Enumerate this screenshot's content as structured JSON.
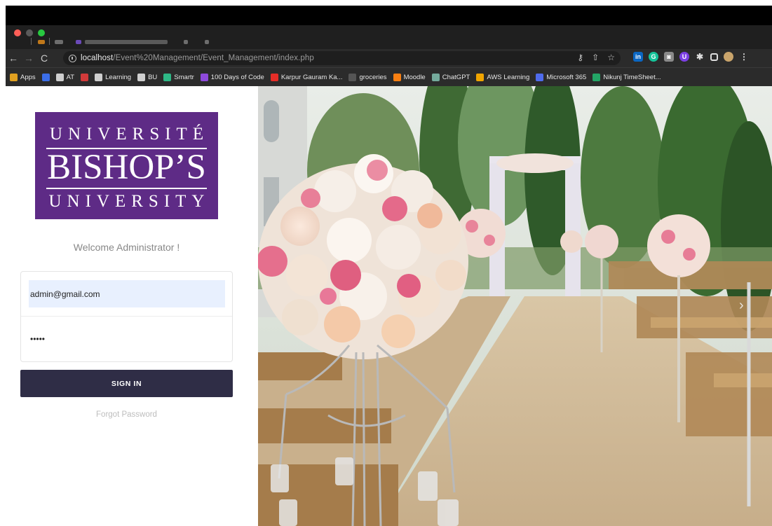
{
  "browser": {
    "url_host": "localhost",
    "url_path": "/Event%20Management/Event_Management/index.php",
    "omnibox_icons": [
      "key-icon",
      "share-icon",
      "star-icon"
    ],
    "extension_icons": [
      "linkedin-icon",
      "grammarly-icon",
      "camera-icon",
      "extension-u-icon",
      "puzzle-icon",
      "sidepanel-icon",
      "profile-icon",
      "menu-icon"
    ],
    "bookmarks": [
      {
        "label": "Apps",
        "icon": "apps-grid-icon",
        "color": "#e0a020"
      },
      {
        "label": "",
        "icon": "bookmark-blue-icon",
        "color": "#3b6ee8"
      },
      {
        "label": "AT",
        "icon": "globe-icon",
        "color": "#cfcfcf"
      },
      {
        "label": "",
        "icon": "bookmark-red-icon",
        "color": "#d23a3a"
      },
      {
        "label": "Learning",
        "icon": "folder-icon",
        "color": "#cfcfcf"
      },
      {
        "label": "BU",
        "icon": "folder-icon",
        "color": "#cfcfcf"
      },
      {
        "label": "Smartr",
        "icon": "smartr-icon",
        "color": "#2eb886"
      },
      {
        "label": "100 Days of Code",
        "icon": "code-icon",
        "color": "#8e4adb"
      },
      {
        "label": "Karpur Gauram Ka...",
        "icon": "youtube-icon",
        "color": "#e52d27"
      },
      {
        "label": "groceries",
        "icon": "groceries-icon",
        "color": "#555555"
      },
      {
        "label": "Moodle",
        "icon": "moodle-icon",
        "color": "#f98012"
      },
      {
        "label": "ChatGPT",
        "icon": "chatgpt-icon",
        "color": "#74aa9c"
      },
      {
        "label": "AWS Learning",
        "icon": "aws-icon",
        "color": "#f0a500"
      },
      {
        "label": "Microsoft 365",
        "icon": "microsoft365-icon",
        "color": "#4f6bed"
      },
      {
        "label": "Nikunj TimeSheet...",
        "icon": "sheets-icon",
        "color": "#23a566"
      }
    ]
  },
  "logo": {
    "line1": "UNIVERSITÉ",
    "line2": "BISHOP’S",
    "line3": "UNIVERSITY",
    "color": "#5e2b86"
  },
  "login": {
    "welcome": "Welcome Administrator !",
    "email_value": "admin@gmail.com",
    "password_value": "•••••",
    "signin_label": "SIGN IN",
    "forgot_label": "Forgot Password",
    "button_color": "#2f2d46"
  },
  "carousel": {
    "next_icon": "chevron-right-icon",
    "next_glyph": "›"
  }
}
